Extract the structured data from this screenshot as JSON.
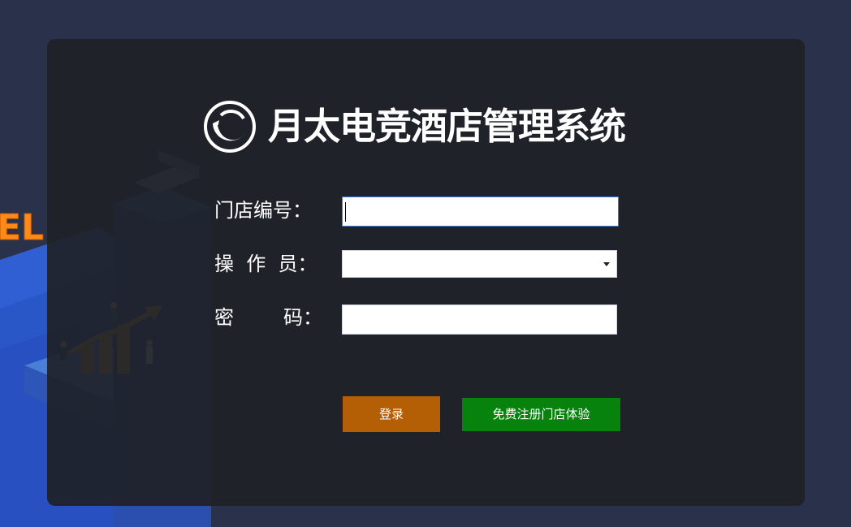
{
  "brand": {
    "title": "月太电竞酒店管理系统",
    "logo_icon": "crescent-moon-logo-icon"
  },
  "background": {
    "partial_text": "EL"
  },
  "form": {
    "store_number_label": "门店编号：",
    "store_number_value": "",
    "operator_label": "操  作  员：",
    "operator_selected": "",
    "password_label": "密        码：",
    "password_value": ""
  },
  "buttons": {
    "login_label": "登录",
    "register_label": "免费注册门店体验"
  },
  "colors": {
    "page_bg": "#29324a",
    "panel_bg": "#1f2128",
    "login_button": "#b45e06",
    "register_button": "#07820d",
    "text": "#ffffff"
  }
}
